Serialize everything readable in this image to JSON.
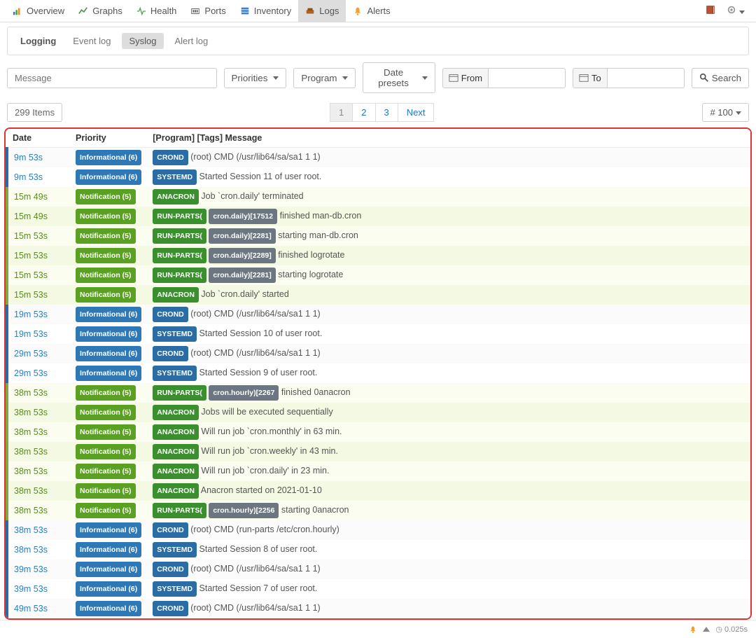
{
  "topnav": {
    "items": [
      {
        "label": "Overview",
        "icon": "overview"
      },
      {
        "label": "Graphs",
        "icon": "graphs"
      },
      {
        "label": "Health",
        "icon": "health"
      },
      {
        "label": "Ports",
        "icon": "ports"
      },
      {
        "label": "Inventory",
        "icon": "inventory"
      },
      {
        "label": "Logs",
        "icon": "logs",
        "active": true
      },
      {
        "label": "Alerts",
        "icon": "alerts"
      }
    ]
  },
  "subnav": {
    "title": "Logging",
    "tabs": [
      {
        "label": "Event log"
      },
      {
        "label": "Syslog",
        "active": true
      },
      {
        "label": "Alert log"
      }
    ]
  },
  "filters": {
    "message_placeholder": "Message",
    "priorities_label": "Priorities",
    "program_label": "Program",
    "date_presets_label": "Date presets",
    "from_label": "From",
    "to_label": "To",
    "search_label": "Search"
  },
  "list": {
    "items_count": "299 Items",
    "pages": [
      "1",
      "2",
      "3",
      "Next"
    ],
    "active_page": "1",
    "pagesize": "# 100"
  },
  "headers": {
    "date": "Date",
    "priority": "Priority",
    "message": "[Program] [Tags] Message"
  },
  "rows": [
    {
      "date": "9m 53s",
      "prio": "info",
      "prio_label": "Informational (6)",
      "program": "CROND",
      "msg": "(root) CMD (/usr/lib64/sa/sa1 1 1)"
    },
    {
      "date": "9m 53s",
      "prio": "info",
      "prio_label": "Informational (6)",
      "program": "SYSTEMD",
      "msg": "Started Session 11 of user root."
    },
    {
      "date": "15m 49s",
      "prio": "notif",
      "prio_label": "Notification (5)",
      "program": "ANACRON",
      "msg": "Job `cron.daily' terminated"
    },
    {
      "date": "15m 49s",
      "prio": "notif",
      "prio_label": "Notification (5)",
      "program": "RUN-PARTS(",
      "tag": "cron.daily)[17512",
      "msg": "finished man-db.cron"
    },
    {
      "date": "15m 53s",
      "prio": "notif",
      "prio_label": "Notification (5)",
      "program": "RUN-PARTS(",
      "tag": "cron.daily)[2281]",
      "msg": "starting man-db.cron"
    },
    {
      "date": "15m 53s",
      "prio": "notif",
      "prio_label": "Notification (5)",
      "program": "RUN-PARTS(",
      "tag": "cron.daily)[2289]",
      "msg": "finished logrotate"
    },
    {
      "date": "15m 53s",
      "prio": "notif",
      "prio_label": "Notification (5)",
      "program": "RUN-PARTS(",
      "tag": "cron.daily)[2281]",
      "msg": "starting logrotate"
    },
    {
      "date": "15m 53s",
      "prio": "notif",
      "prio_label": "Notification (5)",
      "program": "ANACRON",
      "msg": "Job `cron.daily' started"
    },
    {
      "date": "19m 53s",
      "prio": "info",
      "prio_label": "Informational (6)",
      "program": "CROND",
      "msg": "(root) CMD (/usr/lib64/sa/sa1 1 1)"
    },
    {
      "date": "19m 53s",
      "prio": "info",
      "prio_label": "Informational (6)",
      "program": "SYSTEMD",
      "msg": "Started Session 10 of user root."
    },
    {
      "date": "29m 53s",
      "prio": "info",
      "prio_label": "Informational (6)",
      "program": "CROND",
      "msg": "(root) CMD (/usr/lib64/sa/sa1 1 1)"
    },
    {
      "date": "29m 53s",
      "prio": "info",
      "prio_label": "Informational (6)",
      "program": "SYSTEMD",
      "msg": "Started Session 9 of user root."
    },
    {
      "date": "38m 53s",
      "prio": "notif",
      "prio_label": "Notification (5)",
      "program": "RUN-PARTS(",
      "tag": "cron.hourly)[2267",
      "msg": "finished 0anacron"
    },
    {
      "date": "38m 53s",
      "prio": "notif",
      "prio_label": "Notification (5)",
      "program": "ANACRON",
      "msg": "Jobs will be executed sequentially"
    },
    {
      "date": "38m 53s",
      "prio": "notif",
      "prio_label": "Notification (5)",
      "program": "ANACRON",
      "msg": "Will run job `cron.monthly' in 63 min."
    },
    {
      "date": "38m 53s",
      "prio": "notif",
      "prio_label": "Notification (5)",
      "program": "ANACRON",
      "msg": "Will run job `cron.weekly' in 43 min."
    },
    {
      "date": "38m 53s",
      "prio": "notif",
      "prio_label": "Notification (5)",
      "program": "ANACRON",
      "msg": "Will run job `cron.daily' in 23 min."
    },
    {
      "date": "38m 53s",
      "prio": "notif",
      "prio_label": "Notification (5)",
      "program": "ANACRON",
      "msg": "Anacron started on 2021-01-10"
    },
    {
      "date": "38m 53s",
      "prio": "notif",
      "prio_label": "Notification (5)",
      "program": "RUN-PARTS(",
      "tag": "cron.hourly)[2256",
      "msg": "starting 0anacron"
    },
    {
      "date": "38m 53s",
      "prio": "info",
      "prio_label": "Informational (6)",
      "program": "CROND",
      "msg": "(root) CMD (run-parts /etc/cron.hourly)"
    },
    {
      "date": "38m 53s",
      "prio": "info",
      "prio_label": "Informational (6)",
      "program": "SYSTEMD",
      "msg": "Started Session 8 of user root."
    },
    {
      "date": "39m 53s",
      "prio": "info",
      "prio_label": "Informational (6)",
      "program": "CROND",
      "msg": "(root) CMD (/usr/lib64/sa/sa1 1 1)"
    },
    {
      "date": "39m 53s",
      "prio": "info",
      "prio_label": "Informational (6)",
      "program": "SYSTEMD",
      "msg": "Started Session 7 of user root."
    },
    {
      "date": "49m 53s",
      "prio": "info",
      "prio_label": "Informational (6)",
      "program": "CROND",
      "msg": "(root) CMD (/usr/lib64/sa/sa1 1 1)"
    }
  ],
  "footer": {
    "time": "0.025s"
  }
}
